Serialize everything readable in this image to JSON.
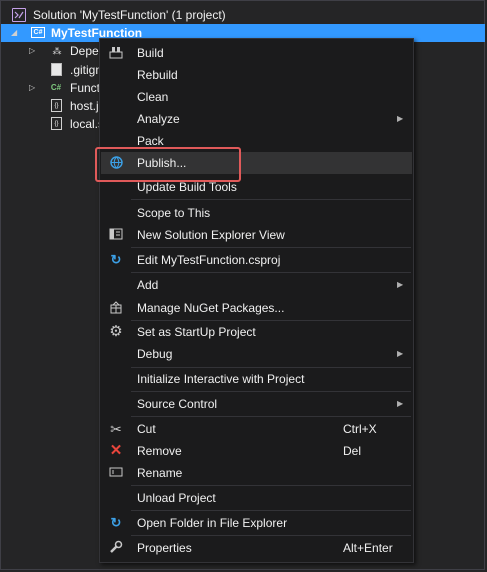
{
  "solution": {
    "title": "Solution 'MyTestFunction' (1 project)",
    "project": "MyTestFunction",
    "project_badge": "C#",
    "items": [
      {
        "label": "Depen",
        "icon": "dependencies-icon",
        "expandable": true
      },
      {
        "label": ".gitign",
        "icon": "file-icon",
        "expandable": false
      },
      {
        "label": "Functi",
        "icon": "csharp-file-icon",
        "expandable": true
      },
      {
        "label": "host.j",
        "icon": "json-file-icon",
        "expandable": false
      },
      {
        "label": "local.s",
        "icon": "json-file-icon",
        "expandable": false
      }
    ]
  },
  "menu": {
    "items": {
      "build": {
        "label": "Build",
        "icon": "build-icon"
      },
      "rebuild": {
        "label": "Rebuild"
      },
      "clean": {
        "label": "Clean"
      },
      "analyze": {
        "label": "Analyze",
        "submenu": true
      },
      "pack": {
        "label": "Pack"
      },
      "publish": {
        "label": "Publish...",
        "icon": "publish-globe-icon"
      },
      "update_build_tools": {
        "label": "Update Build Tools"
      },
      "scope_to_this": {
        "label": "Scope to This"
      },
      "new_solution_explorer_view": {
        "label": "New Solution Explorer View",
        "icon": "solution-explorer-view-icon"
      },
      "edit_csproj": {
        "label": "Edit MyTestFunction.csproj",
        "icon": "edit-refresh-icon"
      },
      "add": {
        "label": "Add",
        "submenu": true
      },
      "manage_nuget": {
        "label": "Manage NuGet Packages...",
        "icon": "nuget-package-icon"
      },
      "set_startup": {
        "label": "Set as StartUp Project",
        "icon": "gear-icon"
      },
      "debug": {
        "label": "Debug",
        "submenu": true
      },
      "initialize_interactive": {
        "label": "Initialize Interactive with Project"
      },
      "source_control": {
        "label": "Source Control",
        "submenu": true
      },
      "cut": {
        "label": "Cut",
        "shortcut": "Ctrl+X",
        "icon": "scissors-icon"
      },
      "remove": {
        "label": "Remove",
        "shortcut": "Del",
        "icon": "remove-x-icon"
      },
      "rename": {
        "label": "Rename",
        "icon": "rename-icon"
      },
      "unload_project": {
        "label": "Unload Project"
      },
      "open_folder": {
        "label": "Open Folder in File Explorer",
        "icon": "open-folder-icon"
      },
      "properties": {
        "label": "Properties",
        "shortcut": "Alt+Enter",
        "icon": "wrench-icon"
      }
    },
    "hovered_item": "publish"
  },
  "colors": {
    "background": "#252526",
    "menu_background": "#1b1b1c",
    "selection": "#3399ff",
    "highlight_border": "#e05a5a",
    "hover": "#333334"
  }
}
